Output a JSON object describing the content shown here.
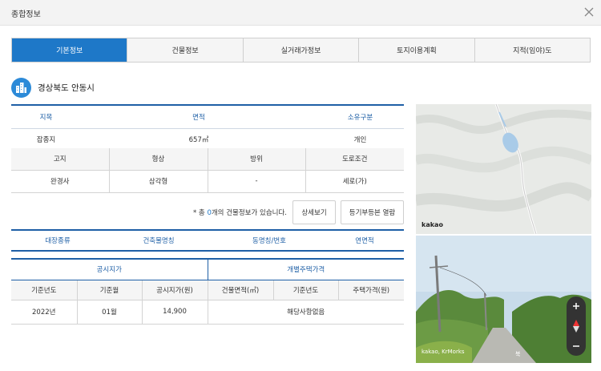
{
  "header": {
    "title": "종합정보"
  },
  "tabs": [
    {
      "label": "기본정보"
    },
    {
      "label": "건물정보"
    },
    {
      "label": "실거래가정보"
    },
    {
      "label": "토지이용계획"
    },
    {
      "label": "지적(임야)도"
    }
  ],
  "location": {
    "name": "경상북도 안동시"
  },
  "land": {
    "headers": {
      "jimok": "지목",
      "area": "면적",
      "ownership": "소유구분"
    },
    "values": {
      "jimok": "잡종지",
      "area": "657㎡",
      "ownership": "개인"
    }
  },
  "terrain": {
    "headers": [
      "고지",
      "형상",
      "방위",
      "도로조건"
    ],
    "values": [
      "완경사",
      "삼각형",
      "-",
      "세로(가)"
    ]
  },
  "notice": {
    "prefix": "* 총 ",
    "count": "0",
    "suffix": "개의 건물정보가 있습니다.",
    "detail_button": "상세보기",
    "registry_button": "등기부등본 열람"
  },
  "building": {
    "headers": [
      "대장종류",
      "건축물명칭",
      "동명칭/번호",
      "연면적"
    ]
  },
  "price": {
    "groups": {
      "public": "공시지가",
      "housing": "개별주택가격"
    },
    "headers": [
      "기준년도",
      "기준월",
      "공시지가(원)",
      "건물면적(㎡)",
      "기준년도",
      "주택가격(원)"
    ],
    "values": {
      "year": "2022년",
      "month": "01월",
      "price": "14,900",
      "housing": "해당사항없음"
    }
  },
  "map": {
    "brand": "kakao"
  },
  "roadview": {
    "credit": "kakao, KrMorks",
    "north": "북"
  }
}
